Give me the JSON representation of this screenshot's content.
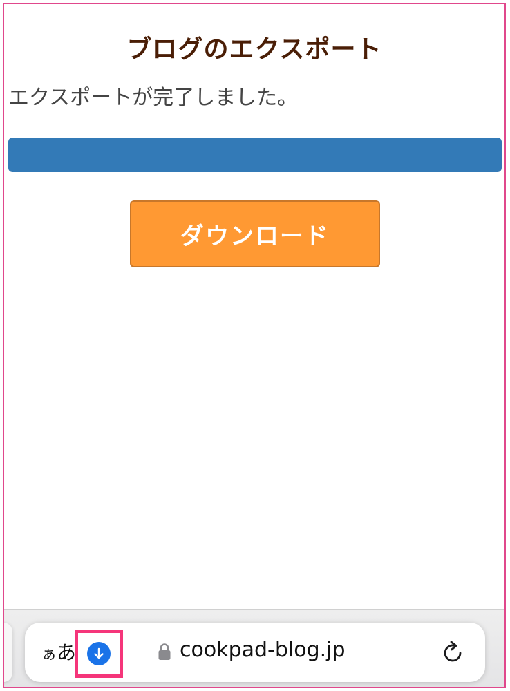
{
  "page": {
    "title": "ブログのエクスポート",
    "status_text": "エクスポートが完了しました。",
    "progress_percent": 100,
    "download_label": "ダウンロード"
  },
  "browser": {
    "text_size_label_small": "ぁ",
    "text_size_label_large": "あ",
    "url": "cookpad-blog.jp",
    "icons": {
      "download": "arrow-down-circle-icon",
      "lock": "lock-icon",
      "reload": "reload-icon"
    }
  },
  "colors": {
    "title": "#4a1e06",
    "progress": "#337ab7",
    "download_button": "#ff9933",
    "highlight": "#f5357a",
    "download_indicator": "#1a73e8"
  }
}
